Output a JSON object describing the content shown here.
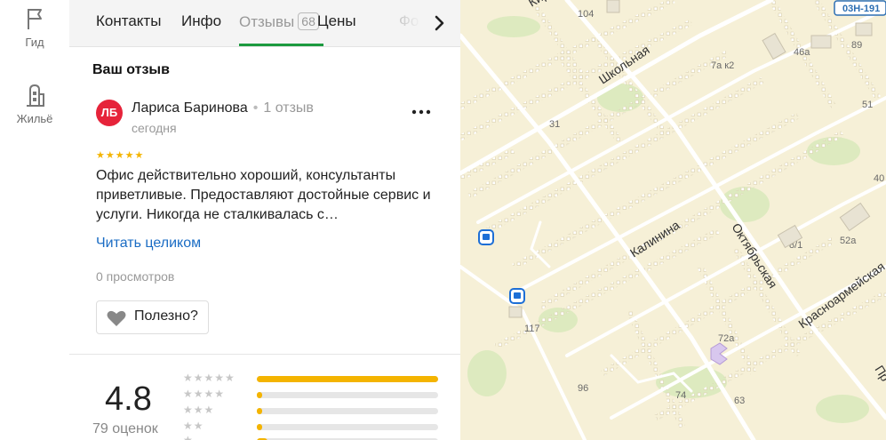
{
  "rail": {
    "items": [
      {
        "label": "Гид",
        "icon": "flag-icon"
      },
      {
        "label": "Жильё",
        "icon": "building-icon"
      }
    ]
  },
  "tabs": {
    "items": [
      {
        "label": "Контакты"
      },
      {
        "label": "Инфо"
      },
      {
        "label": "Отзывы",
        "count": "68",
        "active": true
      },
      {
        "label": "Цены"
      },
      {
        "label": "Фо"
      }
    ]
  },
  "review": {
    "section_title": "Ваш отзыв",
    "avatar_initials": "ЛБ",
    "author": "Лариса Баринова",
    "author_reviews": "1 отзыв",
    "date": "сегодня",
    "stars": "★★★★★",
    "rating_value": 5,
    "text": "Офис действительно хороший, консультанты приветливые. Предоставляют достойные сервис и услуги. Никогда не сталкивалась с…",
    "read_more": "Читать целиком",
    "views": "0 просмотров",
    "useful_label": "Полезно?"
  },
  "rating": {
    "value": "4.8",
    "count_label": "79 оценок",
    "distribution": [
      {
        "stars": "★★★★★",
        "share": 1.0
      },
      {
        "stars": "★★★★",
        "share": 0.03
      },
      {
        "stars": "★★★",
        "share": 0.03
      },
      {
        "stars": "★★",
        "share": 0.03
      },
      {
        "stars": "★",
        "share": 0.06
      }
    ]
  },
  "map": {
    "road_badge": "03Н-191",
    "street_labels": [
      "Кир",
      "Школьная",
      "Калинина",
      "Октябрьская",
      "Красноармейская",
      "Пр"
    ],
    "house_numbers": [
      "104",
      "7а к2",
      "46а",
      "89",
      "51",
      "31",
      "40",
      "8/1",
      "52а",
      "117",
      "72а",
      "96",
      "74",
      "63"
    ]
  },
  "colors": {
    "accent_green": "#1c9a3f",
    "star_yellow": "#f4b400",
    "avatar_red": "#e6233a",
    "link_blue": "#1a6cc4",
    "map_background": "#f6f0d7",
    "transit_blue": "#1d6fd6"
  }
}
